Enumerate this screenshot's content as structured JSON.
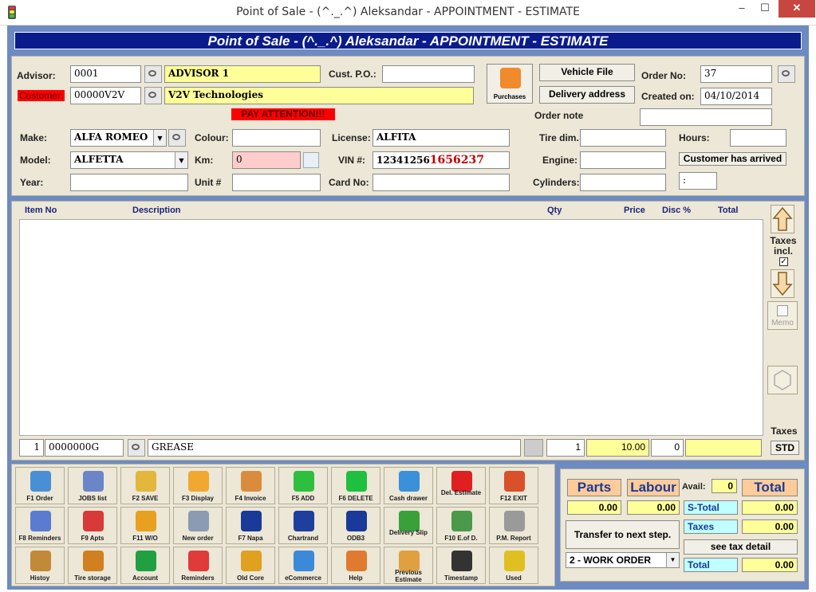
{
  "window": {
    "title": "Point of Sale - (^._.^) Aleksandar - APPOINTMENT - ESTIMATE",
    "minimize": "–",
    "maximize": "☐",
    "close": "✕"
  },
  "banner": "Point of Sale - (^._.^) Aleksandar - APPOINTMENT - ESTIMATE",
  "header": {
    "advisor_label": "Advisor:",
    "advisor_code": "0001",
    "advisor_name": "ADVISOR 1",
    "customer_label": "Customer:",
    "customer_code": "00000V2V",
    "customer_name": "V2V Technologies",
    "cust_po_label": "Cust. P.O.:",
    "cust_po": "",
    "purchases_label": "Purchases",
    "vehicle_file": "Vehicle File",
    "delivery_address": "Delivery address",
    "order_no_label": "Order No:",
    "order_no": "37",
    "created_on_label": "Created on:",
    "created_on": "04/10/2014",
    "order_note_label": "Order note",
    "order_note": "",
    "pay_attention": "PAY ATTENTION!!!",
    "make_label": "Make:",
    "make": "ALFA ROMEO",
    "model_label": "Model:",
    "model": "ALFETTA",
    "year_label": "Year:",
    "year": "",
    "colour_label": "Colour:",
    "colour": "",
    "km_label": "Km:",
    "km": "0",
    "unit_label": "Unit #",
    "unit": "",
    "license_label": "License:",
    "license": "ALFITA",
    "vin_label": "VIN #:",
    "vin_part1": "12341256",
    "vin_part2": "1656237",
    "card_label": "Card No:",
    "card": "",
    "tire_label": "Tire dim.",
    "tire": "",
    "engine_label": "Engine:",
    "engine": "",
    "cylinders_label": "Cylinders:",
    "cylinders": "",
    "hours_label": "Hours:",
    "hours": "",
    "customer_arrived": "Customer has arrived",
    "time_field": ":"
  },
  "table": {
    "columns": {
      "item_no": "Item No",
      "description": "Description",
      "qty": "Qty",
      "price": "Price",
      "disc": "Disc %",
      "total": "Total"
    },
    "entry": {
      "line": "1",
      "item_no": "0000000G",
      "description": "GREASE",
      "qty": "1",
      "price": "10.00",
      "disc": "0",
      "total": ""
    }
  },
  "side": {
    "taxes_incl": "Taxes incl.",
    "memo": "Memo",
    "taxes": "Taxes",
    "std": "STD"
  },
  "tools": [
    {
      "label": "F1 Order",
      "icon": "order-icon",
      "color": "#4a8fd6"
    },
    {
      "label": "JOBS list",
      "icon": "jobs-list-icon",
      "color": "#6a86c9"
    },
    {
      "label": "F2 SAVE",
      "icon": "save-icon",
      "color": "#e2b73b"
    },
    {
      "label": "F3 Display",
      "icon": "display-icon",
      "color": "#f0a830"
    },
    {
      "label": "F4 Invoice",
      "icon": "invoice-icon",
      "color": "#d98d3c"
    },
    {
      "label": "F5 ADD",
      "icon": "add-icon",
      "color": "#2fbf3f"
    },
    {
      "label": "F6 DELETE",
      "icon": "delete-icon",
      "color": "#1fbf3f"
    },
    {
      "label": "Cash drawer",
      "icon": "cash-drawer-icon",
      "color": "#3a90d9"
    },
    {
      "label": "Del. Estimate",
      "icon": "delete-estimate-icon",
      "color": "#e02020"
    },
    {
      "label": "F12 EXIT",
      "icon": "exit-icon",
      "color": "#d9502a"
    },
    {
      "label": "F8 Reminders",
      "icon": "reminders-icon",
      "color": "#5a7bd0"
    },
    {
      "label": "F9 Apts",
      "icon": "calendar-icon",
      "color": "#d83a3a"
    },
    {
      "label": "F11 W/O",
      "icon": "work-order-icon",
      "color": "#e8a020"
    },
    {
      "label": "New order",
      "icon": "new-order-icon",
      "color": "#8a9bb3"
    },
    {
      "label": "F7 Napa",
      "icon": "napa-logo-icon",
      "color": "#1a3a9a"
    },
    {
      "label": "Chartrand",
      "icon": "uniprix-logo-icon",
      "color": "#1f3f9f"
    },
    {
      "label": "ODB3",
      "icon": "obd3-logo-icon",
      "color": "#1a3a9a"
    },
    {
      "label": "Delivery Slip",
      "icon": "delivery-slip-icon",
      "color": "#3aa03a"
    },
    {
      "label": "F10 E.of D.",
      "icon": "end-of-day-icon",
      "color": "#4b9a4b"
    },
    {
      "label": "P.M. Report",
      "icon": "report-icon",
      "color": "#9a9a9a"
    },
    {
      "label": "Histoy",
      "icon": "history-icon",
      "color": "#c08a3a"
    },
    {
      "label": "Tire storage",
      "icon": "tire-storage-icon",
      "color": "#d08020"
    },
    {
      "label": "Account",
      "icon": "dollar-icon",
      "color": "#20a040"
    },
    {
      "label": "Reminders",
      "icon": "bell-icon",
      "color": "#e03a3a"
    },
    {
      "label": "Old Core",
      "icon": "core-icon",
      "color": "#e0a020"
    },
    {
      "label": "eCommerce",
      "icon": "ecommerce-icon",
      "color": "#3a8ad9"
    },
    {
      "label": "Help",
      "icon": "help-icon",
      "color": "#e07a30"
    },
    {
      "label": "Previous Estimate",
      "icon": "previous-icon",
      "color": "#e0a040"
    },
    {
      "label": "Timestamp",
      "icon": "scanner-icon",
      "color": "#333333"
    },
    {
      "label": "Used",
      "icon": "used-car-icon",
      "color": "#e0c020"
    }
  ],
  "totals": {
    "parts": "Parts",
    "labour": "Labour",
    "avail_label": "Avail:",
    "avail": "0",
    "total": "Total",
    "parts_value": "0.00",
    "labour_value": "0.00",
    "s_total_label": "S-Total",
    "s_total": "0.00",
    "taxes_label": "Taxes",
    "taxes": "0.00",
    "total_label": "Total",
    "total_value": "0.00",
    "transfer": "Transfer to next step.",
    "see_tax": "see tax detail",
    "step": "2 - WORK ORDER"
  }
}
